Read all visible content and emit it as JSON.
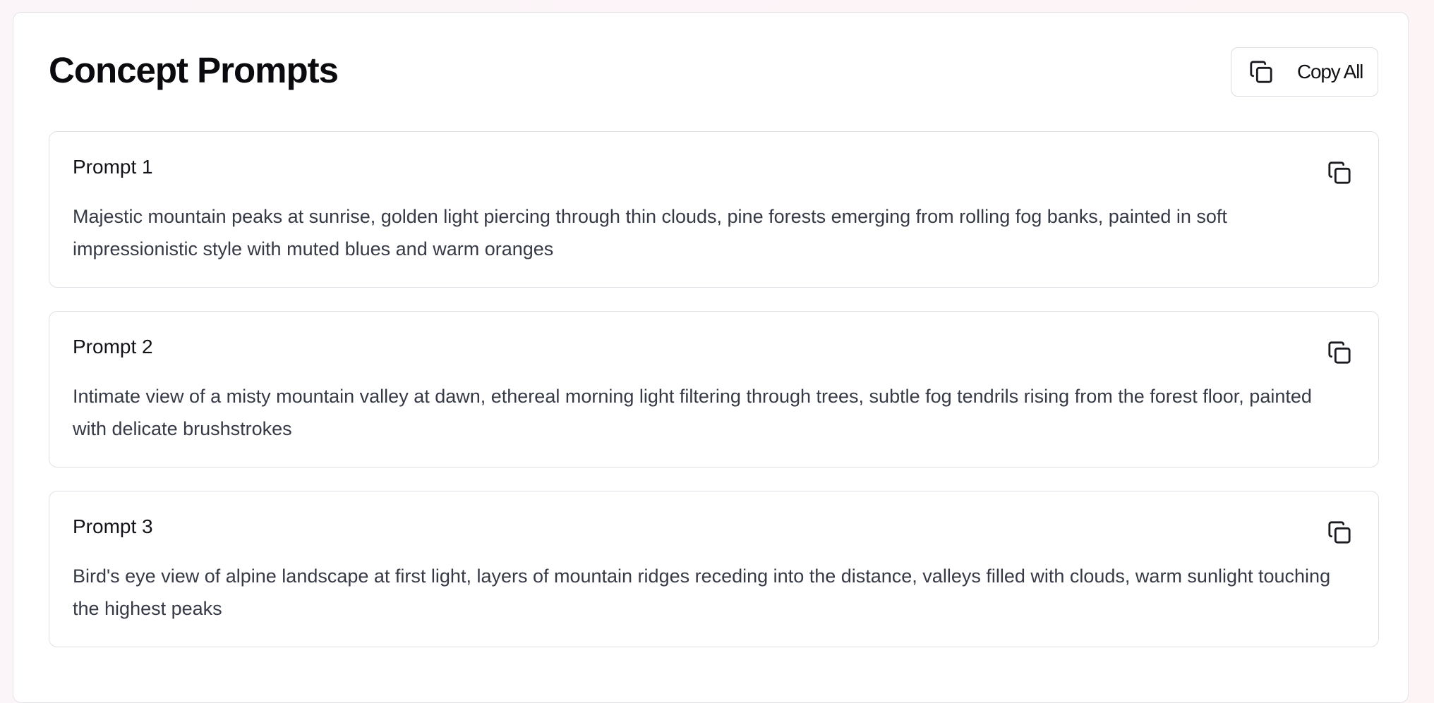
{
  "header": {
    "title": "Concept Prompts",
    "copy_all_label": "Copy All",
    "copy_all_icon": "copy-icon"
  },
  "prompts": [
    {
      "title": "Prompt 1",
      "text": "Majestic mountain peaks at sunrise, golden light piercing through thin clouds, pine forests emerging from rolling fog banks, painted in soft impressionistic style with muted blues and warm oranges",
      "icon": "copy-icon"
    },
    {
      "title": "Prompt 2",
      "text": "Intimate view of a misty mountain valley at dawn, ethereal morning light filtering through trees, subtle fog tendrils rising from the forest floor, painted with delicate brushstrokes",
      "icon": "copy-icon"
    },
    {
      "title": "Prompt 3",
      "text": "Bird's eye view of alpine landscape at first light, layers of mountain ridges receding into the distance, valleys filled with clouds, warm sunlight touching the highest peaks",
      "icon": "copy-icon"
    }
  ],
  "colors": {
    "background": "#fdf4f7",
    "panel": "#ffffff",
    "border": "#e0e0e6",
    "title_text": "#0b0b0f",
    "body_text": "#363a46"
  }
}
